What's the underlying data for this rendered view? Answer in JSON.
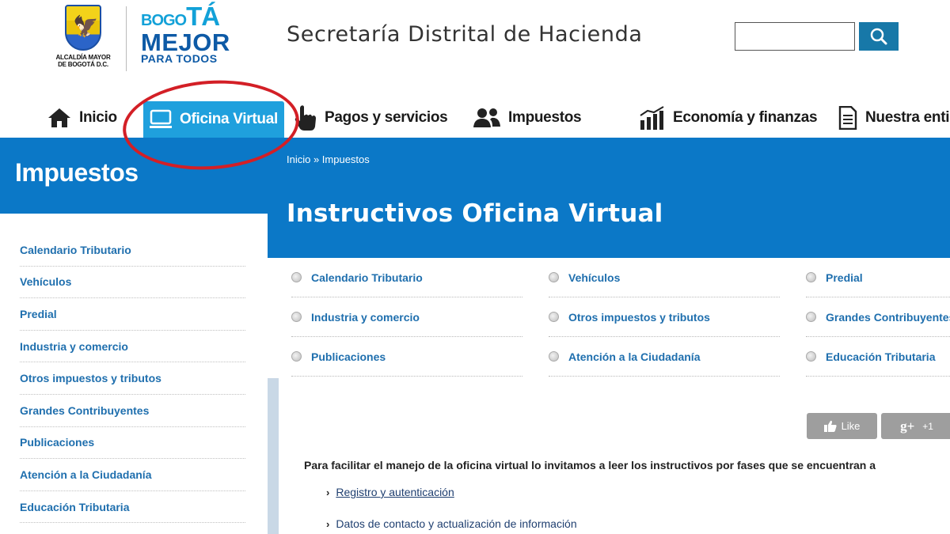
{
  "header": {
    "crest_text_line1": "ALCALDÍA MAYOR",
    "crest_text_line2": "DE BOGOTÁ D.C.",
    "logo_line1_prefix": "BOGO",
    "logo_line1_suffix": "TÁ",
    "logo_line2": "MEJOR",
    "logo_line3": "PARA TODOS",
    "site_title": "Secretaría Distrital de Hacienda",
    "search_value": ""
  },
  "nav": [
    {
      "label": "Inicio",
      "icon": "home-icon"
    },
    {
      "label": "Oficina Virtual",
      "icon": "monitor-icon",
      "active": true
    },
    {
      "label": "Pagos y servicios",
      "icon": "hand-pointer-icon"
    },
    {
      "label": "Impuestos",
      "icon": "users-icon"
    },
    {
      "label": "Economía y finanzas",
      "icon": "bar-chart-icon"
    },
    {
      "label": "Nuestra enti",
      "icon": "document-icon"
    }
  ],
  "sidebar": {
    "title": "Impuestos",
    "items": [
      "Calendario Tributario",
      "Vehículos",
      "Predial",
      "Industria y comercio",
      "Otros impuestos y tributos",
      "Grandes Contribuyentes",
      "Publicaciones",
      "Atención a la Ciudadanía",
      "Educación Tributaria"
    ]
  },
  "breadcrumb": "Inicio » Impuestos",
  "page_title": "Instructivos Oficina Virtual",
  "topic_grid": [
    [
      "Calendario Tributario",
      "Vehículos",
      "Predial"
    ],
    [
      "Industria y comercio",
      "Otros impuestos y tributos",
      "Grandes Contribuyentes"
    ],
    [
      "Publicaciones",
      "Atención a la Ciudadanía",
      "Educación Tributaria"
    ]
  ],
  "social": {
    "like": "Like",
    "gplus_icon": "g+",
    "gplus_count": "+1"
  },
  "intro": "Para facilitar el manejo de la oficina virtual lo invitamos a leer los instructivos por fases que se encuentran a",
  "links": [
    "Registro y autenticación",
    "Datos de contacto y actualización de información"
  ],
  "colors": {
    "primary_blue": "#0b78c7",
    "active_tab": "#1fa0dd",
    "link": "#1f6fae",
    "annotation_red": "#d31f26"
  }
}
